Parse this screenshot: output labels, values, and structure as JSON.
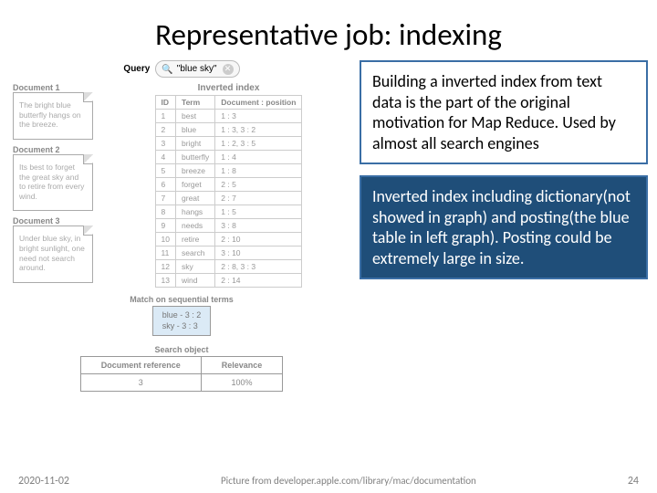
{
  "title": "Representative job: indexing",
  "query": {
    "label": "Query",
    "text": "\"blue sky\""
  },
  "documents": [
    {
      "label": "Document 1",
      "text": "The bright blue butterfly hangs on the breeze."
    },
    {
      "label": "Document 2",
      "text": "Its best to forget the great sky and to retire from every wind."
    },
    {
      "label": "Document 3",
      "text": "Under blue sky, in bright sunlight, one need not search around."
    }
  ],
  "inverted_index": {
    "label": "Inverted index",
    "headers": [
      "ID",
      "Term",
      "Document : position"
    ],
    "rows": [
      [
        "1",
        "best",
        "1 : 3"
      ],
      [
        "2",
        "blue",
        "1 : 3, 3 : 2"
      ],
      [
        "3",
        "bright",
        "1 : 2, 3 : 5"
      ],
      [
        "4",
        "butterfly",
        "1 : 4"
      ],
      [
        "5",
        "breeze",
        "1 : 8"
      ],
      [
        "6",
        "forget",
        "2 : 5"
      ],
      [
        "7",
        "great",
        "2 : 7"
      ],
      [
        "8",
        "hangs",
        "1 : 5"
      ],
      [
        "9",
        "needs",
        "3 : 8"
      ],
      [
        "10",
        "retire",
        "2 : 10"
      ],
      [
        "11",
        "search",
        "3 : 10"
      ],
      [
        "12",
        "sky",
        "2 : 8, 3 : 3"
      ],
      [
        "13",
        "wind",
        "2 : 14"
      ]
    ]
  },
  "match": {
    "label": "Match on sequential terms",
    "lines": [
      "blue - 3 : 2",
      "sky  - 3 : 3"
    ]
  },
  "search_object": {
    "label": "Search object",
    "headers": [
      "Document reference",
      "Relevance"
    ],
    "row": [
      "3",
      "100%"
    ]
  },
  "callouts": {
    "box1": "Building a inverted index from text data is the part of the original motivation for Map Reduce. Used by almost all search engines",
    "box2": "Inverted index including dictionary(not showed in graph) and posting(the blue table in left graph). Posting could be extremely large in size."
  },
  "footer": {
    "date": "2020-11-02",
    "credit": "Picture from developer.apple.com/library/mac/documentation",
    "page": "24"
  }
}
